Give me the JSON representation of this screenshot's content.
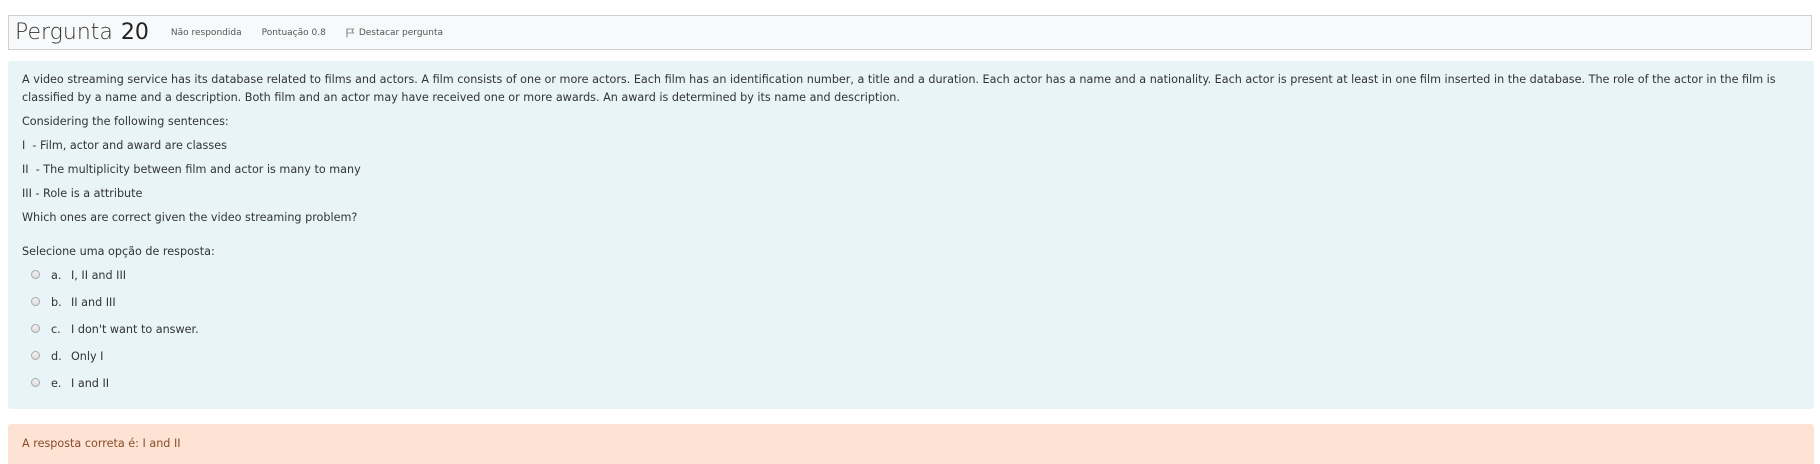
{
  "header": {
    "title_word": "Pergunta",
    "title_number": "20",
    "status": "Não respondida",
    "score": "Pontuação 0.8",
    "flag_label": "Destacar pergunta"
  },
  "question": {
    "paragraphs": [
      "A video streaming service has its database related to films and actors. A film consists of one or more actors. Each film has an identification number, a title and a duration. Each actor has a name and a nationality. Each actor is present at least in one film inserted in the database. The role of the actor in the film is classified by a name and a description. Both film and an actor may have received one or more awards. An award is determined by its name and description.",
      "Considering the following sentences:",
      "I  - Film, actor and award are classes",
      "II  - The multiplicity between film and actor is many to many",
      "III - Role is a attribute",
      "Which ones are correct given the video streaming problem?"
    ],
    "select_prompt": "Selecione uma opção de resposta:",
    "options": [
      {
        "letter": "a.",
        "text": "I, II and III"
      },
      {
        "letter": "b.",
        "text": "II and III"
      },
      {
        "letter": "c.",
        "text": "I don't want to answer."
      },
      {
        "letter": "d.",
        "text": "Only I"
      },
      {
        "letter": "e.",
        "text": "I and II"
      }
    ]
  },
  "feedback": {
    "correct_answer": "A resposta correta é: I and II"
  },
  "colors": {
    "body_bg": "#e8f4f8",
    "feedback_bg": "#fde3d3",
    "feedback_text": "#8a4a2b"
  }
}
